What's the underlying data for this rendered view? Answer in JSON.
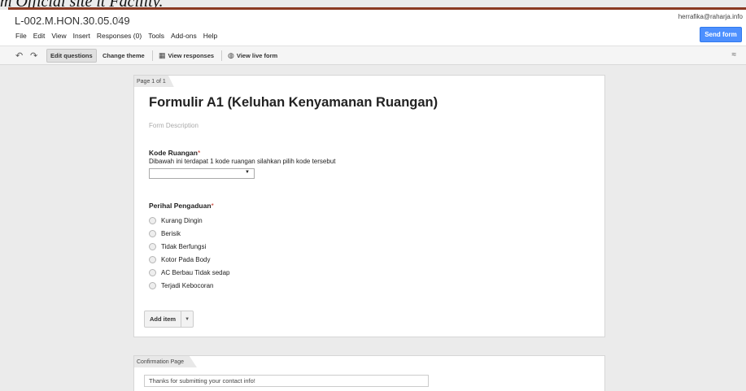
{
  "caption": "m Official site it Facility.",
  "header": {
    "doc_title": "L-002.M.HON.30.05.049",
    "account": "herrafika@raharja.info",
    "send_button": "Send form",
    "menu": [
      "File",
      "Edit",
      "View",
      "Insert",
      "Responses (0)",
      "Tools",
      "Add-ons",
      "Help"
    ]
  },
  "toolbar": {
    "edit_questions": "Edit questions",
    "change_theme": "Change theme",
    "view_responses": "View responses",
    "view_live_form": "View live form"
  },
  "form": {
    "page_tab": "Page 1 of 1",
    "title": "Formulir A1 (Keluhan Kenyamanan Ruangan)",
    "description_placeholder": "Form Description",
    "q1": {
      "title": "Kode Ruangan",
      "required_mark": "*",
      "help": "Dibawah ini terdapat 1 kode ruangan silahkan pilih kode tersebut"
    },
    "q2": {
      "title": "Perihal Pengaduan",
      "required_mark": "*",
      "options": [
        "Kurang Dingin",
        "Berisik",
        "Tidak Berfungsi",
        "Kotor Pada Body",
        "AC Berbau Tidak sedap",
        "Terjadi Kebocoran"
      ]
    },
    "add_item": "Add item"
  },
  "confirmation": {
    "tab": "Confirmation Page",
    "message": "Thanks for submitting your contact info!"
  },
  "colors": {
    "accent": "#4d90fe",
    "rule": "#8b3a22",
    "required": "#c53929"
  }
}
